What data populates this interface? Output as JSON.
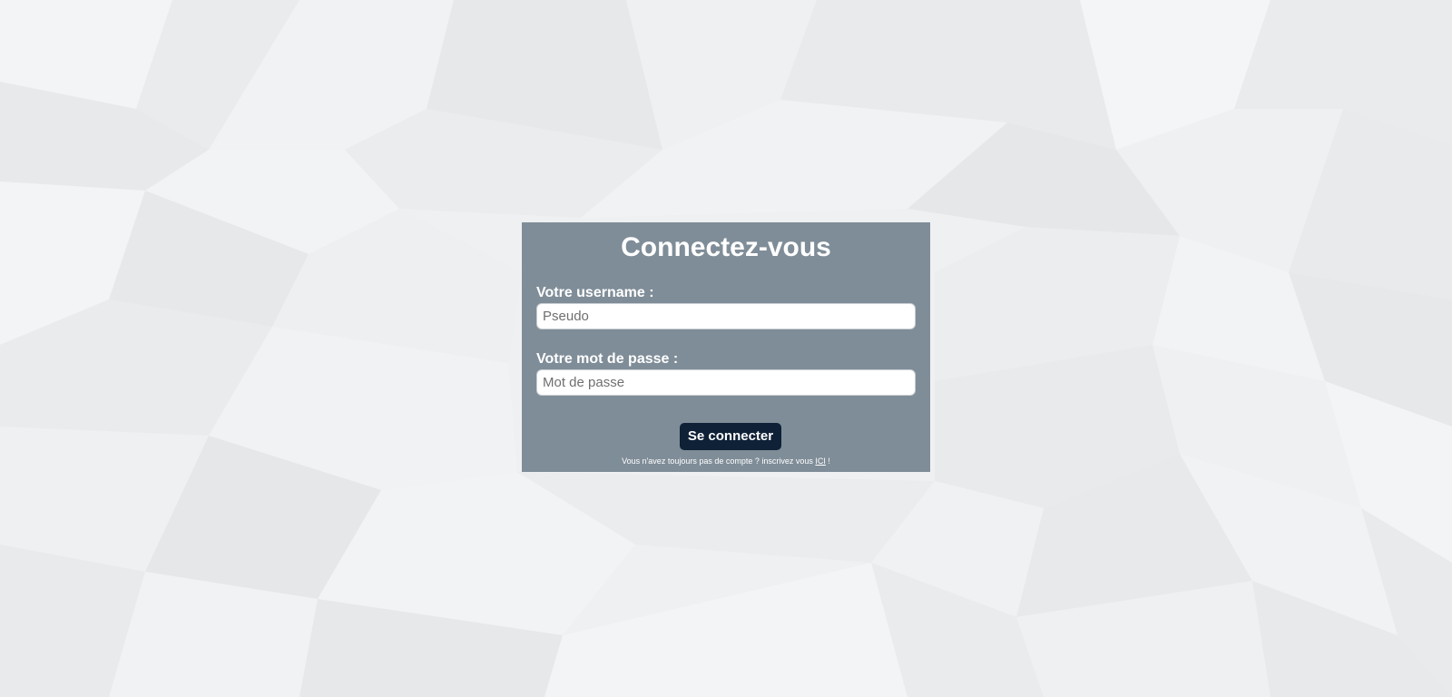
{
  "login": {
    "title": "Connectez-vous",
    "username_label": "Votre username :",
    "username_placeholder": "Pseudo",
    "password_label": "Votre mot de passe :",
    "password_placeholder": "Mot de passe",
    "submit_label": "Se connecter",
    "signup_text_before": "Vous n'avez toujours pas de compte ? inscrivez vous ",
    "signup_link": "ICI",
    "signup_text_after": " !"
  },
  "colors": {
    "background": "#eef0f1",
    "panel": "#7a8793",
    "button": "#0e2136",
    "text": "#ffffff"
  }
}
